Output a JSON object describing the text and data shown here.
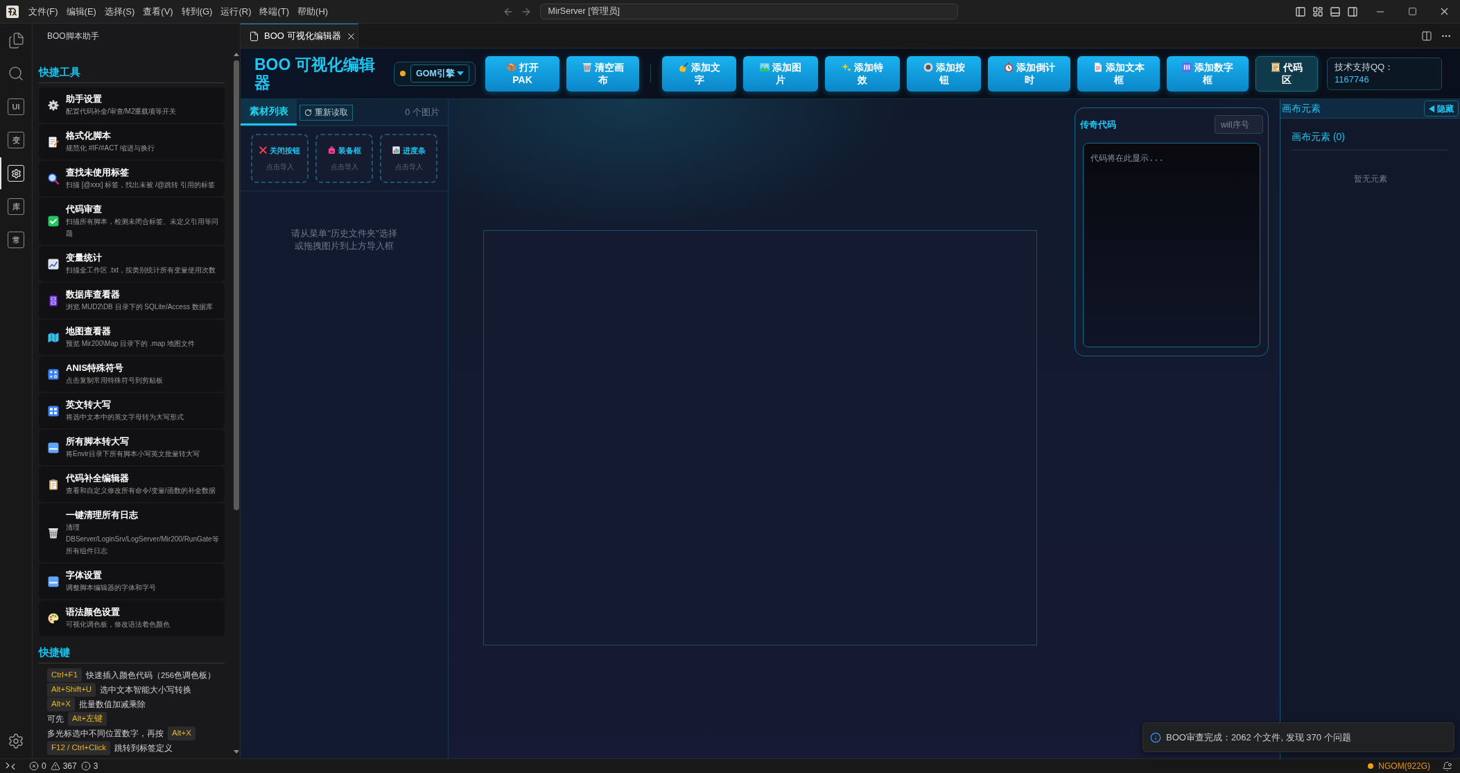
{
  "title_bar": {
    "menu": [
      "文件(F)",
      "编辑(E)",
      "选择(S)",
      "查看(V)",
      "转到(G)",
      "运行(R)",
      "终端(T)",
      "帮助(H)"
    ],
    "command_center": "MirServer [管理员]"
  },
  "activity_bar": [
    {
      "kind": "files",
      "selected": false
    },
    {
      "kind": "search",
      "selected": false
    },
    {
      "kind": "glyph",
      "label": "UI",
      "selected": false
    },
    {
      "kind": "glyph",
      "label": "变",
      "selected": false
    },
    {
      "kind": "gear",
      "selected": true
    },
    {
      "kind": "glyph",
      "label": "库",
      "selected": false
    },
    {
      "kind": "glyph",
      "label": "常",
      "selected": false
    }
  ],
  "sidebar": {
    "title": "BOO脚本助手",
    "tools_heading": "快捷工具",
    "tools": [
      {
        "title": "助手设置",
        "description": "配置代码补全/审查/M2重载项等开关"
      },
      {
        "title": "格式化脚本",
        "description": "规范化 #IF/#ACT 缩进与换行"
      },
      {
        "title": "查找未使用标签",
        "description": "扫描 [@xxx] 标签，找出未被 /@跳转 引用的标签"
      },
      {
        "title": "代码审查",
        "description": "扫描所有脚本，检测未闭合标签、未定义引用等问题"
      },
      {
        "title": "变量统计",
        "description": "扫描全工作区 .txt，按类别统计所有变量使用次数"
      },
      {
        "title": "数据库查看器",
        "description": "浏览 MUD2\\DB 目录下的 SQLite/Access 数据库"
      },
      {
        "title": "地图查看器",
        "description": "预览 Mir200\\Map 目录下的 .map 地图文件"
      },
      {
        "title": "ANIS特殊符号",
        "description": "点击复制常用特殊符号到剪贴板"
      },
      {
        "title": "英文转大写",
        "description": "将选中文本中的英文字母转为大写形式"
      },
      {
        "title": "所有脚本转大写",
        "description": "将Envir目录下所有脚本小写英文批量转大写"
      },
      {
        "title": "代码补全编辑器",
        "description": "查看和自定义修改所有命令/变量/函数的补全数据"
      },
      {
        "title": "一键清理所有日志",
        "description": "清理DBServer/LoginSrv/LogServer/Mir200/RunGate等所有组件日志"
      },
      {
        "title": "字体设置",
        "description": "调整脚本编辑器的字体和字号"
      },
      {
        "title": "语法颜色设置",
        "description": "可视化调色板，修改语法着色颜色"
      }
    ],
    "shortcuts_heading": "快捷键",
    "shortcuts": [
      [
        {
          "kind": "key",
          "text": "Ctrl+F1"
        },
        {
          "kind": "text",
          "text": "快速插入颜色代码（256色调色板）"
        }
      ],
      [
        {
          "kind": "key",
          "text": "Alt+Shift+U"
        },
        {
          "kind": "text",
          "text": "选中文本智能大小写转换"
        }
      ],
      [
        {
          "kind": "key",
          "text": "Alt+X"
        },
        {
          "kind": "text",
          "text": "批量数值加减乘除"
        }
      ],
      [
        {
          "kind": "text",
          "text": "可先"
        },
        {
          "kind": "key",
          "text": "Alt+左键"
        },
        {
          "kind": "text",
          "text": "多光标选中不同位置数字，再按"
        },
        {
          "kind": "key",
          "text": "Alt+X"
        }
      ],
      [
        {
          "kind": "key",
          "text": "F12 / Ctrl+Click"
        },
        {
          "kind": "text",
          "text": "跳转到标签定义"
        }
      ]
    ]
  },
  "editor_tabs": [
    {
      "label": "BOO 可视化编辑器",
      "selected": true
    }
  ],
  "toolbar": {
    "title": "BOO 可视化编辑器",
    "engine": "GOM引擎",
    "button_groups": [
      [
        {
          "label": "打开PAK",
          "on": false
        },
        {
          "label": "清空画布",
          "on": false
        }
      ],
      [
        {
          "label": "添加文字",
          "on": false
        },
        {
          "label": "添加图片",
          "on": false
        },
        {
          "label": "添加特效",
          "on": false
        },
        {
          "label": "添加按钮",
          "on": false
        },
        {
          "label": "添加倒计时",
          "on": false
        },
        {
          "label": "添加文本框",
          "on": false
        },
        {
          "label": "添加数字框",
          "on": false
        },
        {
          "label": "代码区",
          "on": true
        }
      ]
    ],
    "support_label": "技术支持QQ：",
    "support_qq": "1167746"
  },
  "materials": {
    "tabs": [
      {
        "label": "素材列表",
        "selected": true
      }
    ],
    "reload": "重新读取",
    "count": "0 个图片",
    "slots": [
      {
        "label": "关闭按钮",
        "hint": "点击导入"
      },
      {
        "label": "装备框",
        "hint": "点击导入"
      },
      {
        "label": "进度条",
        "hint": "点击导入"
      }
    ],
    "empty_hint": [
      "请从菜单\"历史文件夹\"选择",
      "或拖拽图片到上方导入框"
    ]
  },
  "code_panel": {
    "title": "传奇代码",
    "index_placeholder": "will序号",
    "code_placeholder": "代码将在此显示..."
  },
  "elements_panel": {
    "header": "画布元素",
    "hide_button": "隐藏",
    "title": "画布元素 (0)",
    "empty": "暂无元素"
  },
  "toast": {
    "message": "BOO审查完成：2062 个文件, 发现 370 个问题"
  },
  "status_bar": {
    "errors": "0",
    "warnings": "367",
    "infos": "3",
    "engine": "NGOM(922G)"
  }
}
